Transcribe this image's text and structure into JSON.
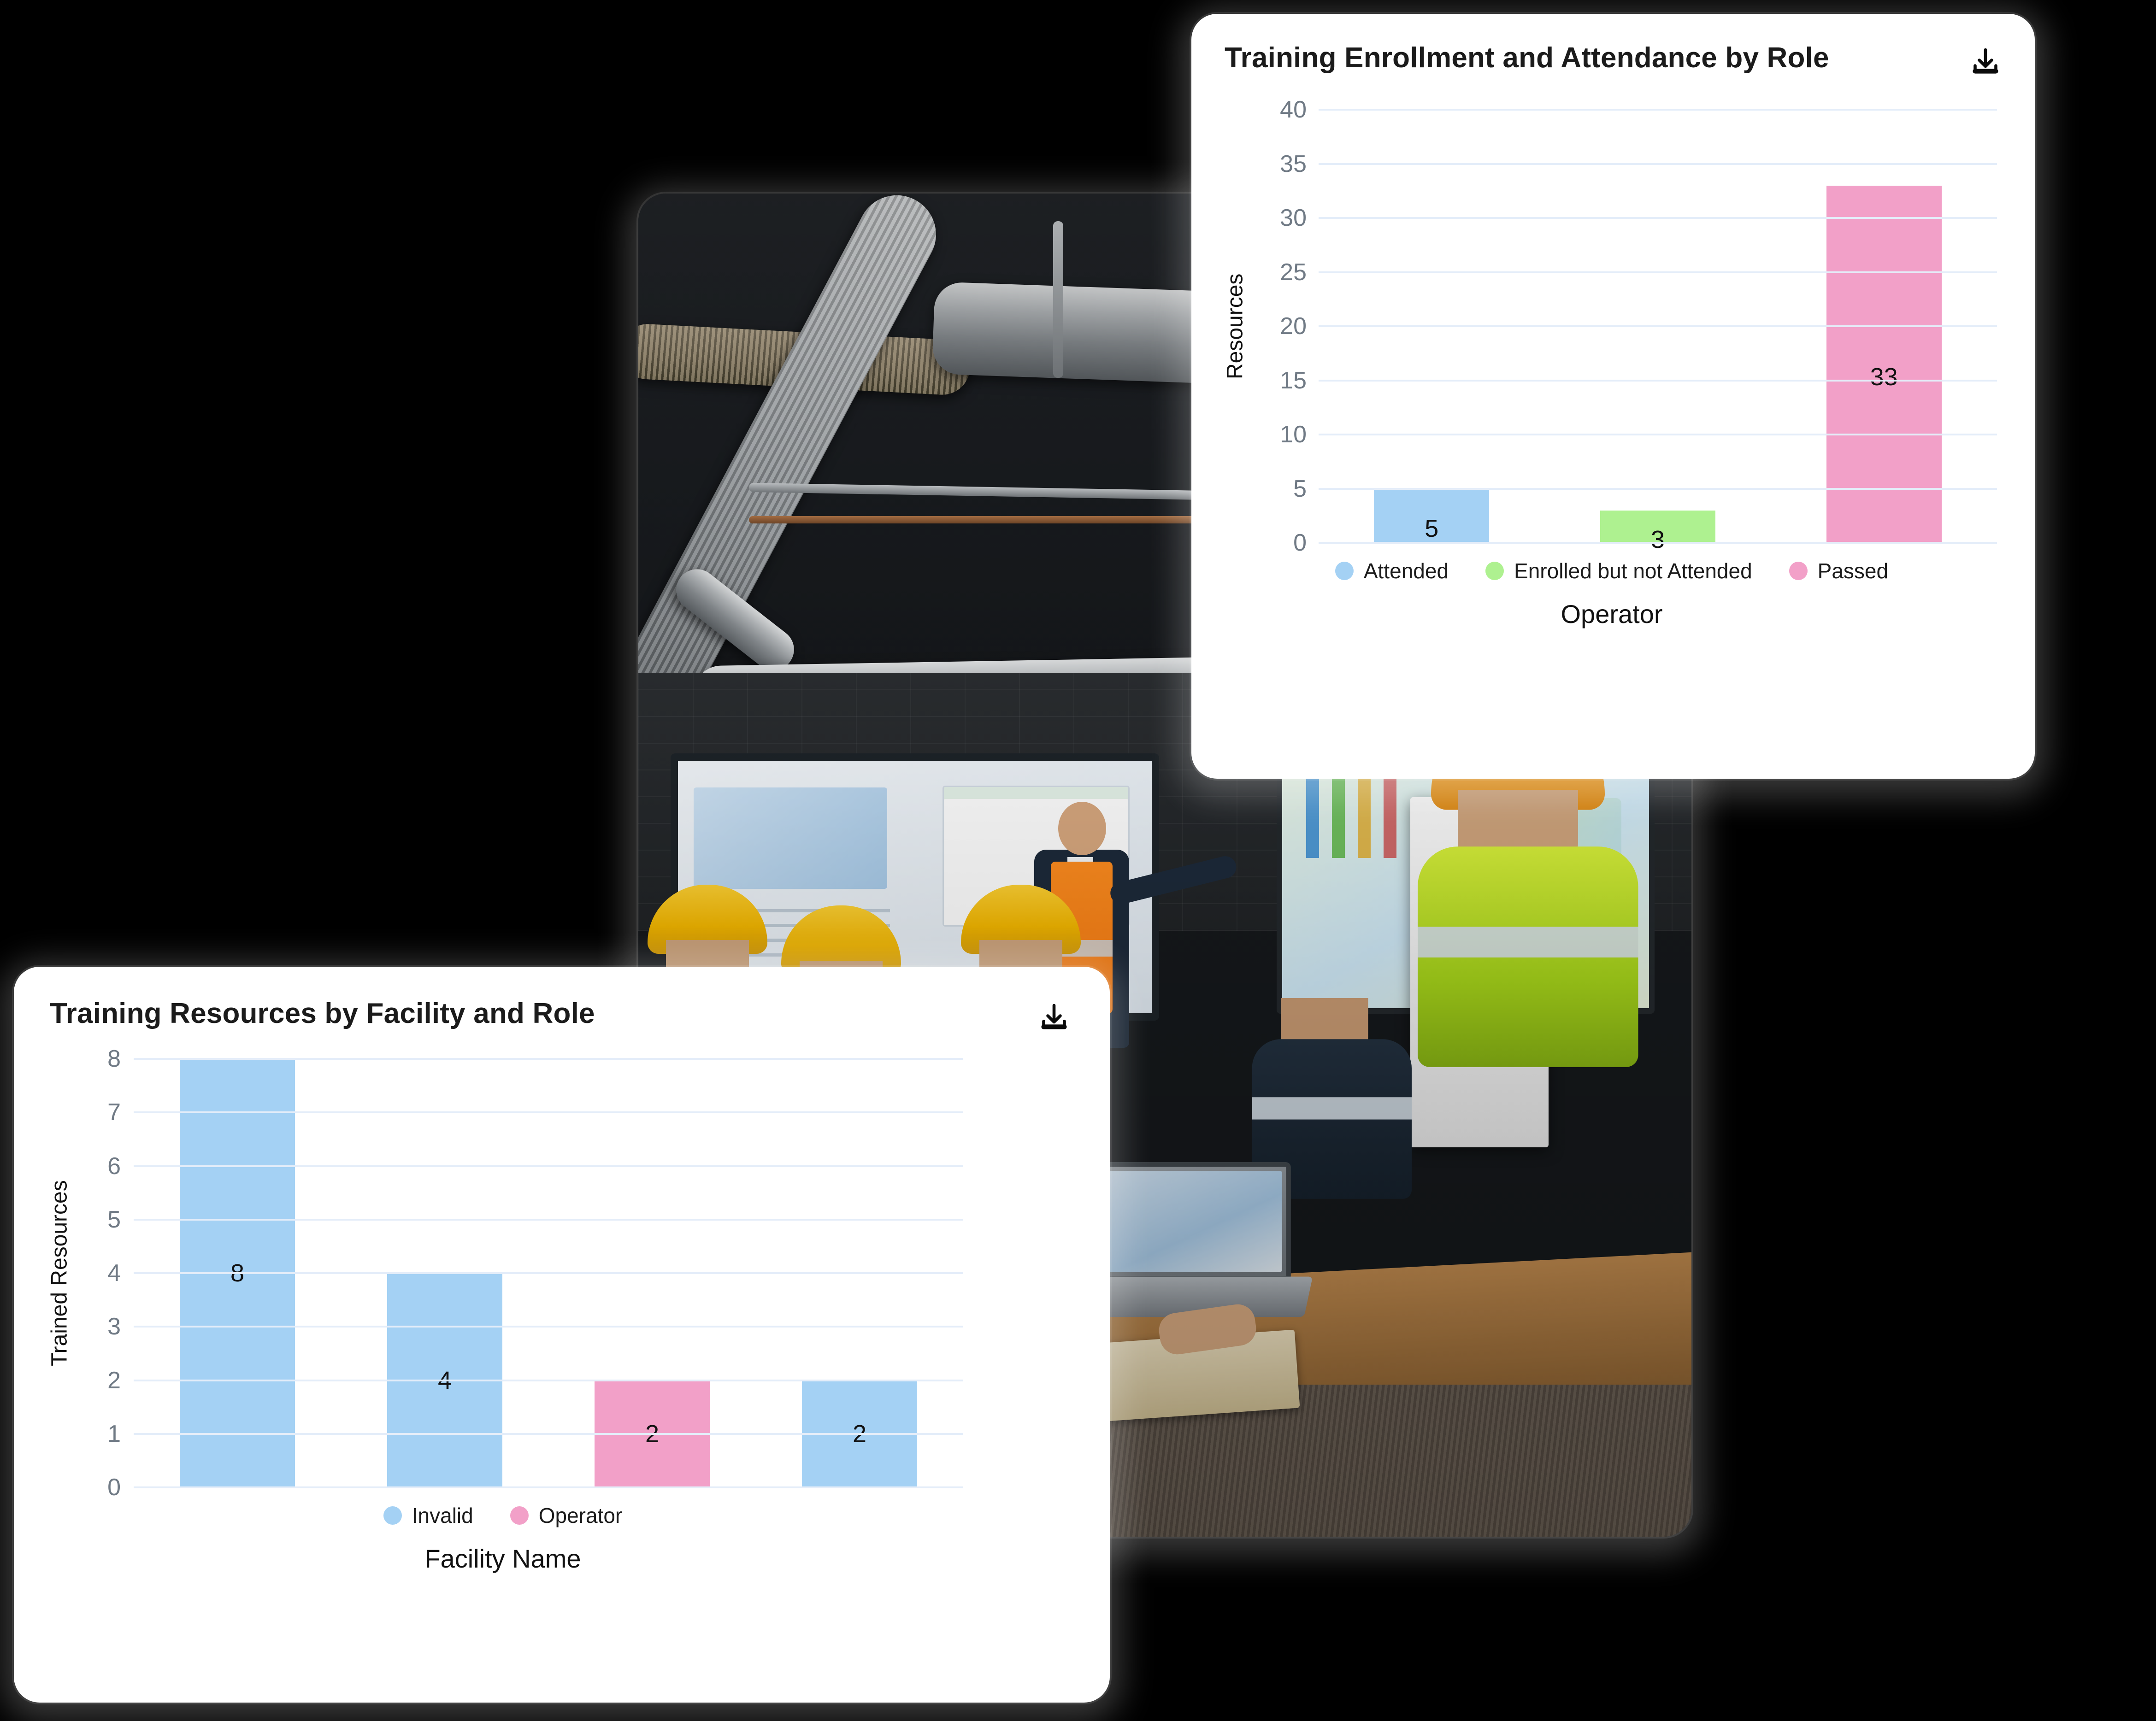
{
  "background_color": "#000000",
  "photo_card": {
    "alt": "Industrial training classroom with instructor, workers in hard hats and hi-vis vests, laptops and presentation screens"
  },
  "cards": [
    {
      "id": "enrollment",
      "title": "Training Enrollment and Attendance by Role",
      "download_icon": "download-icon"
    },
    {
      "id": "resources",
      "title": "Training Resources by Facility and Role",
      "download_icon": "download-icon"
    }
  ],
  "colors": {
    "blue": "#A4D1F4",
    "green": "#AEF190",
    "pink": "#F2A0C8",
    "gridline": "#E4EDF9",
    "tick_text": "#707A85",
    "title_text": "#1B1B1B",
    "card_background": "#FFFFFF"
  },
  "chart_data": [
    {
      "id": "enrollment",
      "type": "bar",
      "title": "Training Enrollment and Attendance by Role",
      "xlabel": "Operator",
      "ylabel": "Resources",
      "ylim": [
        0,
        40
      ],
      "yticks": [
        0,
        5,
        10,
        15,
        20,
        25,
        30,
        35,
        40
      ],
      "grid": true,
      "legend_position": "bottom",
      "categories": [
        "Attended",
        "Enrolled but not Attended",
        "Passed"
      ],
      "values": [
        5,
        3,
        33
      ],
      "bar_colors": [
        "#A4D1F4",
        "#AEF190",
        "#F2A0C8"
      ],
      "data_labels": [
        "5",
        "3",
        "33"
      ],
      "legend": [
        {
          "label": "Attended",
          "color": "#A4D1F4"
        },
        {
          "label": "Enrolled but not Attended",
          "color": "#AEF190"
        },
        {
          "label": "Passed",
          "color": "#F2A0C8"
        }
      ]
    },
    {
      "id": "resources",
      "type": "bar",
      "title": "Training Resources by Facility and Role",
      "xlabel": "Facility Name",
      "ylabel": "Trained Resources",
      "ylim": [
        0,
        8
      ],
      "yticks": [
        0,
        1,
        2,
        3,
        4,
        5,
        6,
        7,
        8
      ],
      "grid": true,
      "legend_position": "bottom",
      "categories": [
        "Invalid",
        "Invalid",
        "Operator",
        "Invalid"
      ],
      "values": [
        8,
        4,
        2,
        2
      ],
      "bar_colors": [
        "#A4D1F4",
        "#A4D1F4",
        "#F2A0C8",
        "#A4D1F4"
      ],
      "data_labels": [
        "8",
        "4",
        "2",
        "2"
      ],
      "legend": [
        {
          "label": "Invalid",
          "color": "#A4D1F4"
        },
        {
          "label": "Operator",
          "color": "#F2A0C8"
        }
      ]
    }
  ]
}
